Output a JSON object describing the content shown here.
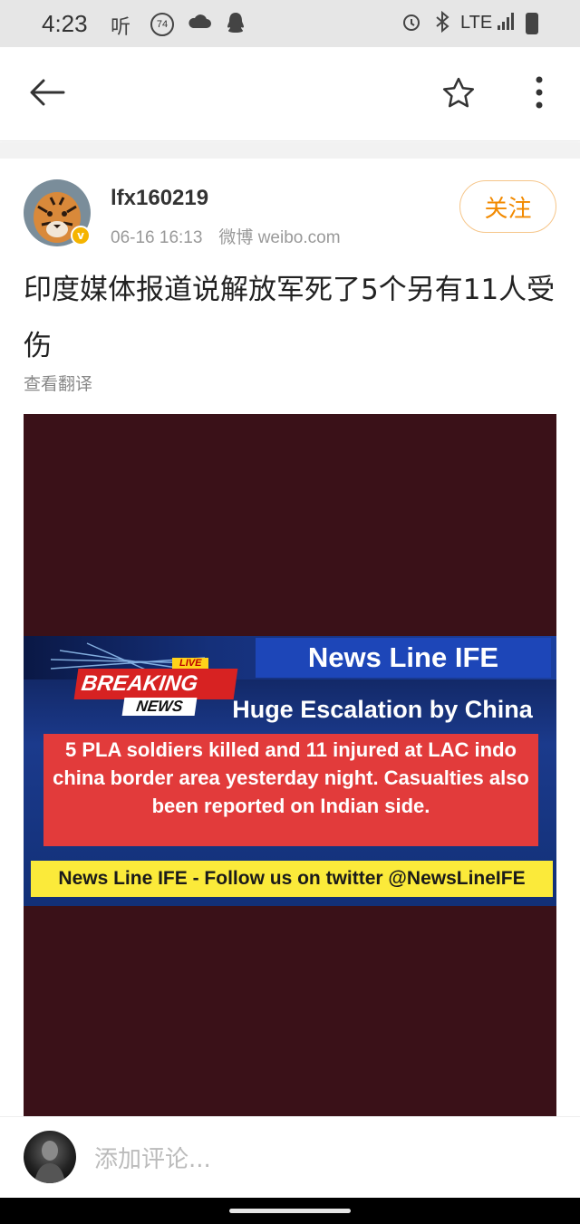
{
  "status_bar": {
    "time": "4:23",
    "aqi": "74",
    "network": "LTE"
  },
  "nav": {
    "back_icon": "arrow-left-icon",
    "star_icon": "star-outline-icon",
    "more_icon": "more-vert-icon"
  },
  "post": {
    "username": "lfx160219",
    "timestamp": "06-16 16:13",
    "source": "微博 weibo.com",
    "follow_label": "关注",
    "text": "印度媒体报道说解放军死了5个另有11人受伤",
    "translate_label": "查看翻译"
  },
  "media": {
    "bg_color": "#3a1118",
    "banner_title": "News Line IFE",
    "live_label": "LIVE",
    "breaking_label": "BREAKING",
    "news_label": "NEWS",
    "headline": "Huge Escalation by China",
    "body": "5 PLA soldiers killed and 11 injured at LAC indo china border area yesterday night. Casualties also been reported on Indian side.",
    "ticker": "News Line IFE - Follow us on twitter @NewsLineIFE"
  },
  "comment": {
    "placeholder": "添加评论..."
  },
  "colors": {
    "accent": "#f28a00",
    "verified": "#f5b400"
  }
}
